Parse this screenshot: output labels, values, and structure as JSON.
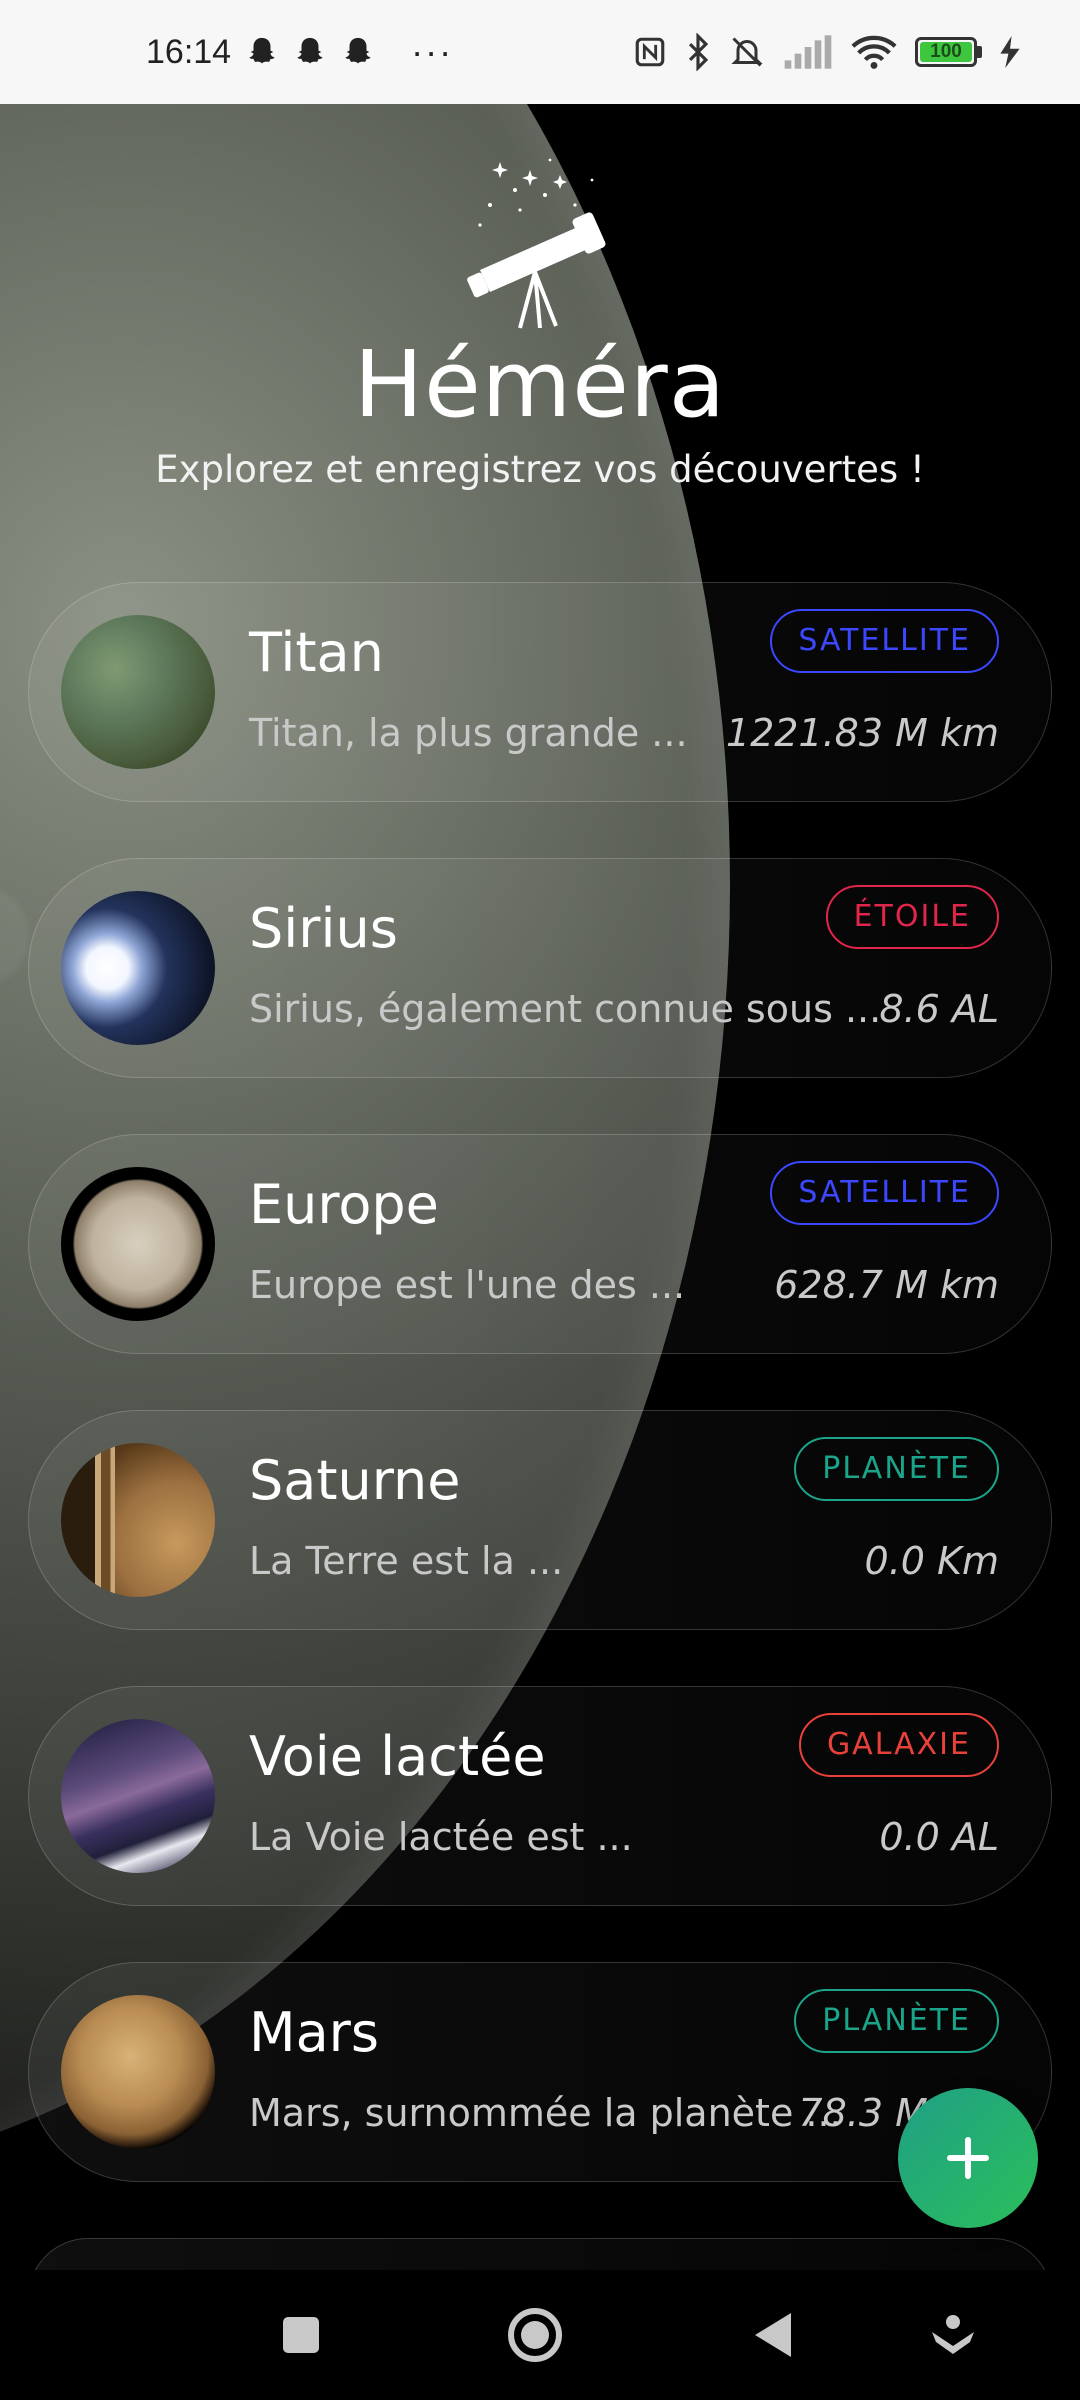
{
  "status_bar": {
    "time": "16:14",
    "notification_icons": [
      "snapchat-ghost-icon",
      "snapchat-ghost-icon",
      "snapchat-ghost-icon"
    ],
    "more": "···",
    "battery_level": "100"
  },
  "header": {
    "title": "Héméra",
    "subtitle": "Explorez et enregistrez vos découvertes !"
  },
  "items": [
    {
      "name": "Titan",
      "description": "Titan, la plus grande ...",
      "category": "SATELLITE",
      "distance": "1221.83 M km",
      "category_color": "#2f3cf0"
    },
    {
      "name": "Sirius",
      "description": "Sirius, également connue sous ...",
      "category": "ÉTOILE",
      "distance": "8.6 AL",
      "category_color": "#e0264a"
    },
    {
      "name": "Europe",
      "description": "Europe est l'une des ...",
      "category": "SATELLITE",
      "distance": "628.7 M km",
      "category_color": "#2f3cf0"
    },
    {
      "name": "Saturne",
      "description": "La Terre est la ...",
      "category": "PLANÈTE",
      "distance": "0.0 Km",
      "category_color": "#1aa58a"
    },
    {
      "name": "Voie lactée",
      "description": "La Voie lactée est ...",
      "category": "GALAXIE",
      "distance": "0.0 AL",
      "category_color": "#e8413a"
    },
    {
      "name": "Mars",
      "description": "Mars, surnommée la planète ...",
      "category": "PLANÈTE",
      "distance": "78.3 M km",
      "category_color": "#1aa58a"
    }
  ],
  "fab": {
    "icon": "plus-icon",
    "color": "#1fa878"
  },
  "nav_bar": {
    "icons": [
      "recents-square-icon",
      "home-circle-icon",
      "back-triangle-icon",
      "assistant-icon"
    ]
  }
}
